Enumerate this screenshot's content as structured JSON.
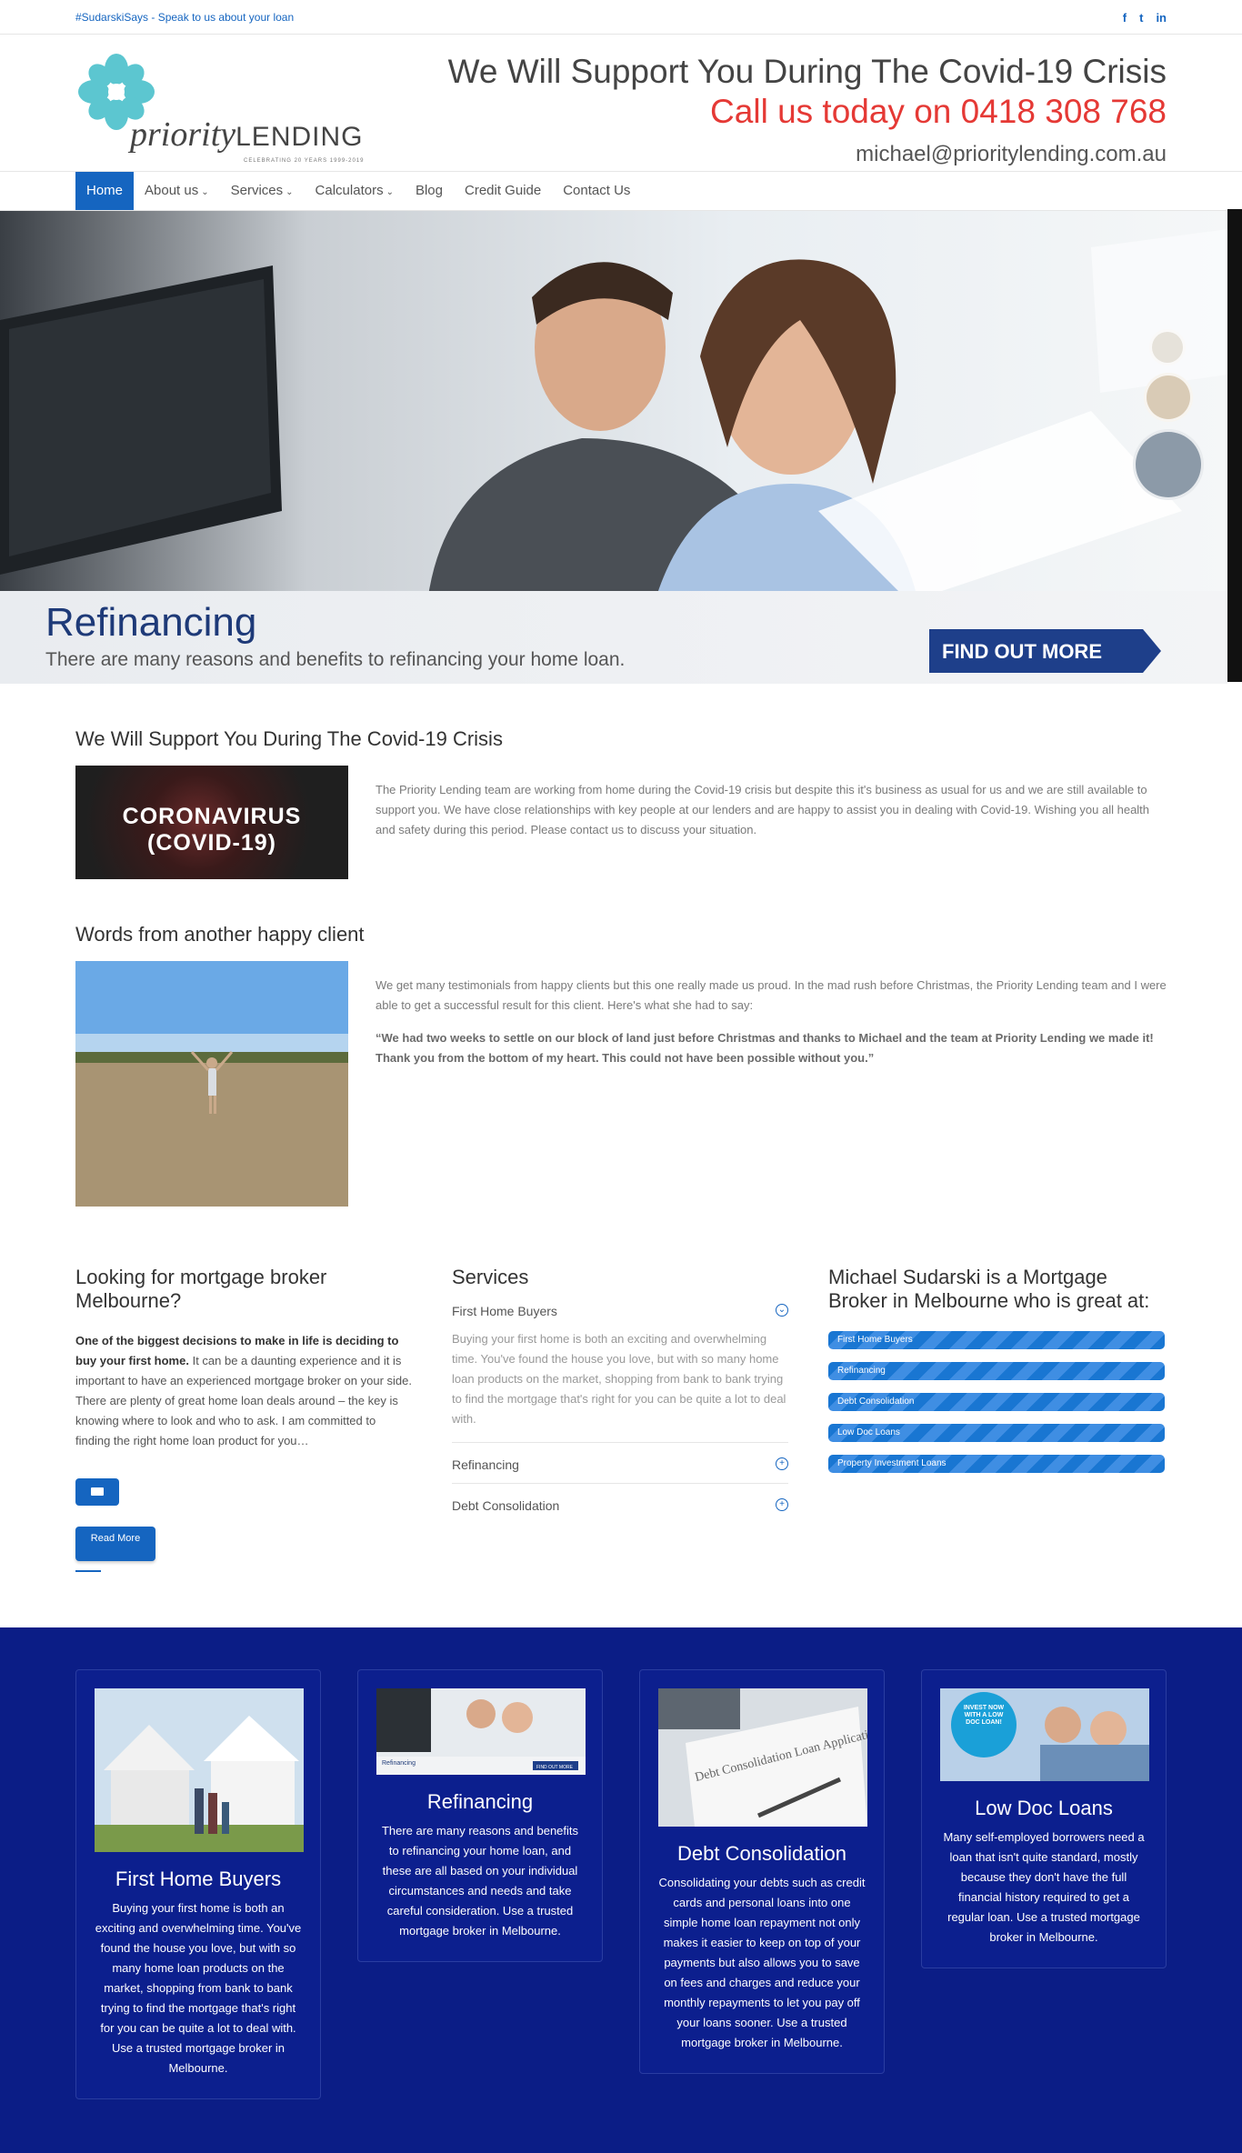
{
  "topbar": {
    "tagline": "#SudarskiSays - Speak to us about your loan",
    "social_icons": [
      "facebook-icon",
      "twitter-icon",
      "linkedin-icon"
    ]
  },
  "header": {
    "logo_word": "priority",
    "logo_word2": "LENDING",
    "logo_sub": "CELEBRATING 20 YEARS 1999-2019",
    "title": "We Will Support You During The Covid-19 Crisis",
    "phone": "Call us today on 0418 308 768",
    "email": "michael@prioritylending.com.au"
  },
  "nav": {
    "items": [
      {
        "label": "Home"
      },
      {
        "label": "About us"
      },
      {
        "label": "Services"
      },
      {
        "label": "Calculators"
      },
      {
        "label": "Blog"
      },
      {
        "label": "Credit Guide"
      },
      {
        "label": "Contact Us"
      }
    ]
  },
  "hero": {
    "title": "Refinancing",
    "subtitle": "There are many reasons and benefits to refinancing your home loan.",
    "cta": "FIND OUT MORE"
  },
  "covid": {
    "heading": "We Will Support You During The Covid-19 Crisis",
    "image_text": "CORONAVIRUS (COVID-19)",
    "body": "The Priority Lending team are working from home during the Covid-19 crisis but despite this it's business as usual for us and we are still available to support you. We have close relationships with key people at our lenders and are happy to assist you in dealing with Covid-19. Wishing you all health and safety during this period. Please contact us to discuss your situation."
  },
  "testimonial": {
    "heading": "Words from another happy client",
    "body": "We get many testimonials from happy clients but this one really made us proud. In the mad rush before Christmas, the Priority Lending team and I were able to get a successful result for this client. Here's what she had to say:",
    "quote": "“We had two weeks to settle on our block of land just before Christmas and thanks to Michael and the team at Priority Lending we made it! Thank you from the bottom of my heart. This could not have been possible without you.”"
  },
  "col1": {
    "heading": "Looking for mortgage broker Melbourne?",
    "lead": "One of the biggest decisions to make in life is deciding to buy your first home.",
    "body": " It can be a daunting experience and it is important to have an experienced mortgage broker on your side. There are plenty of great home loan deals around – the key is knowing where to look and who to ask. I am committed to finding the right home loan product for you…",
    "read_more": "Read More"
  },
  "col2": {
    "heading": "Services",
    "items": [
      {
        "title": "First Home Buyers",
        "body": "Buying your first home is both an exciting and overwhelming time. You've found the house you love, but with so many home loan products on the market, shopping from bank to bank trying to find the mortgage that's right for you can be quite a lot to deal with."
      },
      {
        "title": "Refinancing"
      },
      {
        "title": "Debt Consolidation"
      }
    ]
  },
  "col3": {
    "heading": "Michael Sudarski is a Mortgage Broker in Melbourne who is great at:",
    "bars": [
      "First Home Buyers",
      "Refinancing",
      "Debt Consolidation",
      "Low Doc Loans",
      "Property Investment Loans"
    ]
  },
  "cards": [
    {
      "title": "First Home Buyers",
      "body": "Buying your first home is both an exciting and overwhelming time. You've found the house you love, but with so many home loan products on the market, shopping from bank to bank trying to find the mortgage that's right for you can be quite a lot to deal with. Use a trusted mortgage broker in Melbourne."
    },
    {
      "title": "Refinancing",
      "body": "There are many reasons and benefits to refinancing your home loan, and these are all based on your individual circumstances and needs and take careful consideration. Use a trusted mortgage broker in Melbourne.",
      "img_title": "Refinancing",
      "img_cta": "FIND OUT MORE"
    },
    {
      "title": "Debt Consolidation",
      "body": "Consolidating your debts such as credit cards and personal loans into one simple home loan repayment not only makes it easier to keep on top of your payments but also allows you to save on fees and charges and reduce your monthly repayments to let you pay off your loans sooner. Use a trusted mortgage broker in Melbourne.",
      "img_text": "Debt Consolidation Loan Application Form"
    },
    {
      "title": "Low Doc Loans",
      "body": "Many self-employed borrowers need a loan that isn't quite standard, mostly because they don't have the full financial history required to get a regular loan. Use a trusted mortgage broker in Melbourne.",
      "img_badge": "INVEST NOW WITH A LOW DOC LOAN!"
    }
  ],
  "colors": {
    "brand_blue": "#1565c0",
    "phone_red": "#e53935",
    "footer_navy": "#0b1d86",
    "logo_teal": "#5cc6d0"
  }
}
